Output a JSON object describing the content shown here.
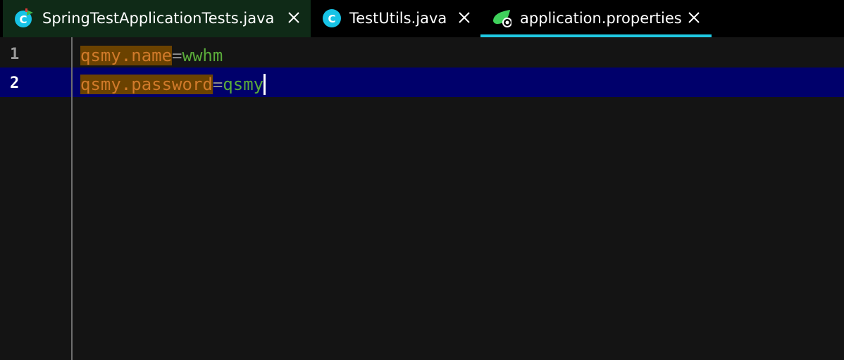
{
  "tabs": [
    {
      "label": "SpringTestApplicationTests.java",
      "icon": "java-class-run-icon",
      "close": "close-icon"
    },
    {
      "label": "TestUtils.java",
      "icon": "java-class-icon",
      "close": "close-icon"
    },
    {
      "label": "application.properties",
      "icon": "spring-properties-icon",
      "close": "close-icon"
    }
  ],
  "editor": {
    "lines": [
      {
        "number": "1",
        "key": "qsmy.name",
        "eq": "=",
        "value": "wwhm"
      },
      {
        "number": "2",
        "key": "qsmy.password",
        "eq": "=",
        "value": "qsmy"
      }
    ]
  },
  "colors": {
    "active_tab_underline": "#1fc9e3",
    "current_line": "#00006b",
    "key_text": "#d07a2a",
    "key_highlight": "#6b4200",
    "value_text": "#5aab3a"
  }
}
